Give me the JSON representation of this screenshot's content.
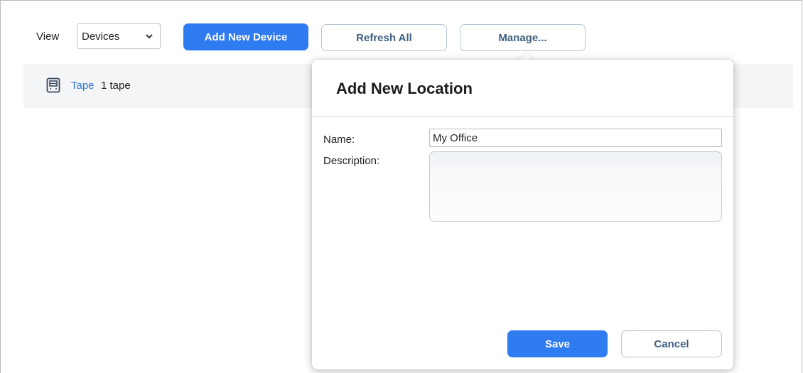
{
  "toolbar": {
    "view_label": "View",
    "view_select_value": "Devices",
    "add_new_device_label": "Add New Device",
    "refresh_all_label": "Refresh All",
    "manage_label": "Manage..."
  },
  "device_list": {
    "items": [
      {
        "name": "Tape",
        "count": "1 tape",
        "icon": "tape-device-icon"
      }
    ]
  },
  "add_location_dialog": {
    "title": "Add New Location",
    "name_label": "Name:",
    "name_value": "My Office",
    "description_label": "Description:",
    "description_value": "",
    "save_label": "Save",
    "cancel_label": "Cancel"
  },
  "colors": {
    "primary_button": "#2f7bf0",
    "secondary_button_text": "#3f5f80",
    "link": "#2e7bd6",
    "row_background": "#f4f5f6"
  }
}
